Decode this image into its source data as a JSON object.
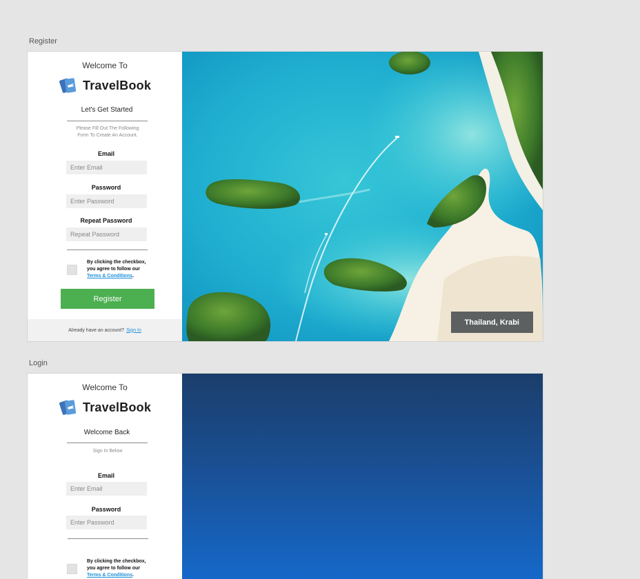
{
  "register": {
    "artboard_label": "Register",
    "welcome": "Welcome To",
    "brand": "TravelBook",
    "subtitle": "Let's Get Started",
    "hint_line1": "Please Fill Out The Following",
    "hint_line2": "Form To Create An Account.",
    "email_label": "Email",
    "email_placeholder": "Enter Email",
    "password_label": "Password",
    "password_placeholder": "Enter Password",
    "repeat_label": "Repeat Password",
    "repeat_placeholder": "Repeat Password",
    "terms_line1": "By clicking the checkbox,",
    "terms_line2": "you agree to follow our",
    "terms_link": "Terms & Conditions",
    "terms_end": ".",
    "button": "Register",
    "footer_text": "Already have an account?",
    "footer_link": "Sign In",
    "caption": "Thailand, Krabi"
  },
  "login": {
    "artboard_label": "Login",
    "welcome": "Welcome To",
    "brand": "TravelBook",
    "subtitle": "Welcome Back",
    "hint": "Sign In Below",
    "email_label": "Email",
    "email_placeholder": "Enter Email",
    "password_label": "Password",
    "password_placeholder": "Enter Password",
    "terms_line1": "By clicking the checkbox,",
    "terms_line2": "you agree to follow our",
    "terms_link": "Terms & Conditions",
    "terms_end": "."
  },
  "colors": {
    "accent_green": "#4caf50",
    "link_blue": "#1a8fd8",
    "login_gradient_top": "#1b3e6b",
    "login_gradient_bottom": "#1568c9"
  }
}
